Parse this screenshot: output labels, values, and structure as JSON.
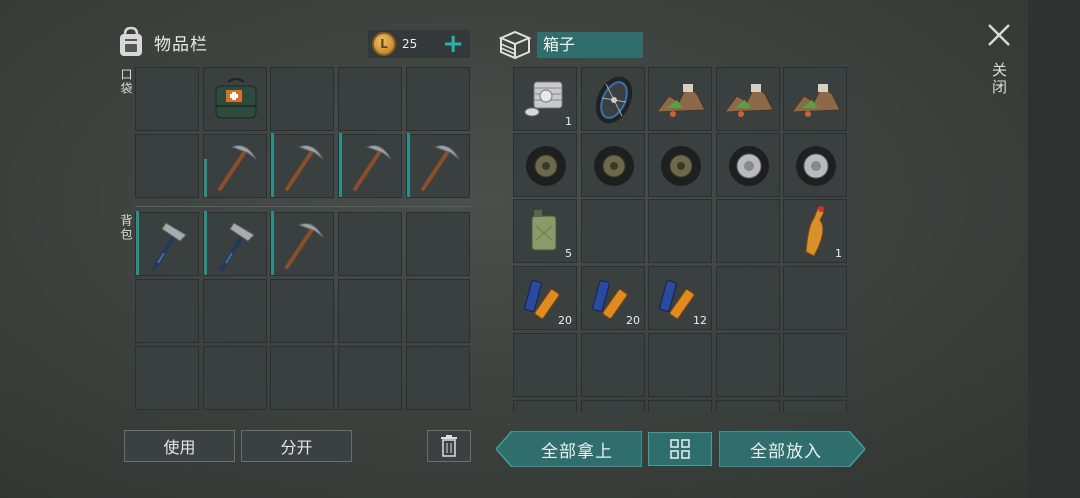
{
  "inventory": {
    "title": "物品栏",
    "coins": "25",
    "coin_symbol": "L",
    "pockets_label": "口袋",
    "backpack_label": "背包",
    "use_label": "使用",
    "split_label": "分开"
  },
  "box": {
    "title": "箱子",
    "take_all_label": "全部拿上",
    "put_all_label": "全部放入",
    "counts": {
      "engine": "1",
      "canister": "5",
      "bottle": "1",
      "battery1": "20",
      "battery2": "20",
      "battery3": "12"
    }
  },
  "close_label": "关闭",
  "colors": {
    "accent": "#2f6e6c",
    "plus": "#27b4a8",
    "durability": "#2a8f8a"
  }
}
